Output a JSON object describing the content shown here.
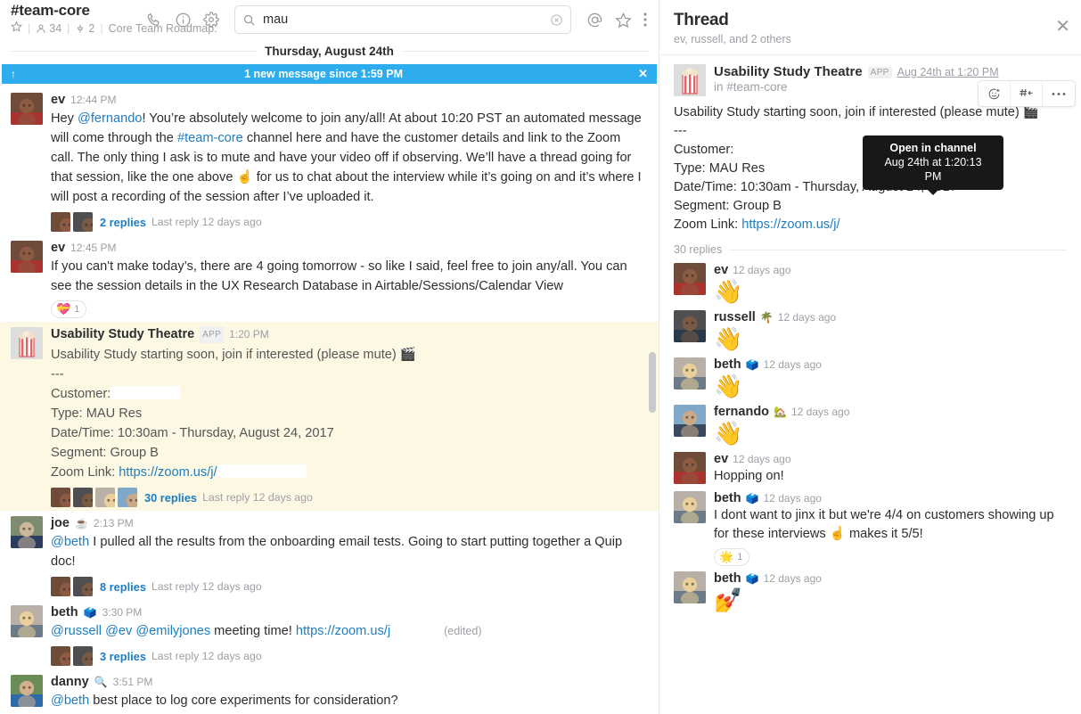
{
  "channel": {
    "name": "#team-core",
    "star_icon": "star-icon",
    "members_icon": "people-icon",
    "members_count": "34",
    "pins_icon": "pin-icon",
    "pins_count": "2",
    "topic": "Core Team Roadmap:"
  },
  "header_actions": {
    "call_icon": "phone-icon",
    "info_icon": "info-icon",
    "settings_icon": "gear-icon",
    "mentions_icon": "at-icon",
    "stars_icon": "star-icon",
    "more_icon": "kebab-menu-icon"
  },
  "search": {
    "icon": "search-icon",
    "value": "mau",
    "placeholder": "Search",
    "clear_icon": "clear-circle-icon"
  },
  "date_divider": "Thursday, August 24th",
  "new_banner": {
    "up_icon": "arrow-up-icon",
    "text": "1 new message since 1:59 PM",
    "close_icon": "close-icon"
  },
  "messages": [
    {
      "author": "ev",
      "time": "12:44 PM",
      "avatar": "avatar-ev",
      "text_parts": [
        {
          "t": "Hey ",
          "k": "plain"
        },
        {
          "t": "@fernando",
          "k": "mention"
        },
        {
          "t": "! You’re absolutely welcome to join any/all! At about 10:20 PST an automated message will come through the ",
          "k": "plain"
        },
        {
          "t": "#team-core",
          "k": "channel"
        },
        {
          "t": " channel here and have the customer details and link to the Zoom call. The only thing I ask is to mute and have your video off if observing. We’ll have a thread going for that session, like the one above ☝️ for us to chat about the interview while it’s going on and it’s where I will post a recording of the session after I’ve uploaded it.",
          "k": "plain"
        }
      ],
      "replies_count": "2 replies",
      "replies_last": "Last reply 12 days ago"
    },
    {
      "author": "ev",
      "time": "12:45 PM",
      "avatar": "avatar-ev",
      "text_parts": [
        {
          "t": "If you can't make today’s, there are 4 going tomorrow - so like I said, feel free to join any/all. You can see the session details in the UX Research Database in Airtable/Sessions/Calendar View",
          "k": "plain"
        }
      ],
      "reactions": [
        {
          "emoji": "💝",
          "count": "1"
        }
      ]
    },
    {
      "author": "Usability Study Theatre",
      "app_tag": "APP",
      "time": "1:20 PM",
      "avatar": "avatar-popcorn-app",
      "highlight": true,
      "lines": [
        "Usability Study starting soon, join if interested (please mute) 🎬",
        "---",
        "Customer:",
        "Type: MAU Res",
        "Date/Time: 10:30am - Thursday, August 24, 2017",
        "Segment: Group B",
        "Zoom Link: https://zoom.us/j/"
      ],
      "replies_count": "30 replies",
      "replies_last": "Last reply 12 days ago"
    },
    {
      "author": "joe",
      "status_emoji": "☕",
      "time": "2:13 PM",
      "avatar": "avatar-joe",
      "text_parts": [
        {
          "t": "@beth",
          "k": "mention"
        },
        {
          "t": " I pulled all the results from the onboarding email tests. Going to start putting together a Quip doc!",
          "k": "plain"
        }
      ],
      "replies_count": "8 replies",
      "replies_last": "Last reply 12 days ago"
    },
    {
      "author": "beth",
      "status_emoji": "🗳️",
      "time": "3:30 PM",
      "avatar": "avatar-beth",
      "text_parts": [
        {
          "t": "@russell",
          "k": "mention"
        },
        {
          "t": " ",
          "k": "plain"
        },
        {
          "t": "@ev",
          "k": "mention"
        },
        {
          "t": " ",
          "k": "plain"
        },
        {
          "t": "@emilyjones",
          "k": "mention"
        },
        {
          "t": " meeting time! ",
          "k": "plain"
        },
        {
          "t": "https://zoom.us/j",
          "k": "link"
        }
      ],
      "edited": "(edited)",
      "replies_count": "3 replies",
      "replies_last": "Last reply 12 days ago"
    },
    {
      "author": "danny",
      "status_emoji": "🔍",
      "time": "3:51 PM",
      "avatar": "avatar-danny",
      "text_parts": [
        {
          "t": "@beth",
          "k": "mention"
        },
        {
          "t": " best place to log core experiments for consideration?",
          "k": "plain"
        }
      ]
    }
  ],
  "thread": {
    "title": "Thread",
    "participants": "ev, russell, and 2 others",
    "close_icon": "close-icon",
    "root": {
      "author": "Usability Study Theatre",
      "app_tag": "APP",
      "timestamp": "Aug 24th at 1:20 PM",
      "channel": "in #team-core",
      "lines": [
        "Usability Study starting soon, join if interested (please mute) 🎬",
        "---",
        "Customer:",
        "Type: MAU Res",
        "Date/Time: 10:30am - Thursday, August 24, 2017",
        "Segment: Group B",
        "Zoom Link: https://zoom.us/j/"
      ]
    },
    "actions": {
      "react_icon": "add-reaction-icon",
      "share_icon": "share-to-channel-icon",
      "more_icon": "more-actions-icon"
    },
    "tooltip": {
      "line1": "Open in channel",
      "line2": "Aug 24th at 1:20:13 PM"
    },
    "replies_label": "30 replies",
    "replies": [
      {
        "author": "ev",
        "time": "12 days ago",
        "avatar": "avatar-ev",
        "text": "👋",
        "big_emoji": true
      },
      {
        "author": "russell",
        "status_emoji": "🌴",
        "time": "12 days ago",
        "avatar": "avatar-russell",
        "text": "👋",
        "big_emoji": true
      },
      {
        "author": "beth",
        "status_emoji": "🗳️",
        "time": "12 days ago",
        "avatar": "avatar-beth",
        "text": "👋",
        "big_emoji": true
      },
      {
        "author": "fernando",
        "status_emoji": "🏡",
        "time": "12 days ago",
        "avatar": "avatar-fernando",
        "text": "👋",
        "big_emoji": true
      },
      {
        "author": "ev",
        "time": "12 days ago",
        "avatar": "avatar-ev",
        "text": "Hopping on!"
      },
      {
        "author": "beth",
        "status_emoji": "🗳️",
        "time": "12 days ago",
        "avatar": "avatar-beth",
        "text": "I dont want to jinx it but we're 4/4 on customers showing up for these interviews ☝️   makes it 5/5!",
        "reactions": [
          {
            "emoji": "🌟",
            "count": "1"
          }
        ]
      },
      {
        "author": "beth",
        "status_emoji": "🗳️",
        "time": "12 days ago",
        "avatar": "avatar-beth",
        "text": "💅",
        "big_emoji": true
      }
    ]
  },
  "colors": {
    "accent_blue": "#1d7dc1",
    "banner_blue": "#2eadee",
    "highlight_yellow": "#fdf8e3",
    "muted_gray": "#9e9ea6"
  }
}
